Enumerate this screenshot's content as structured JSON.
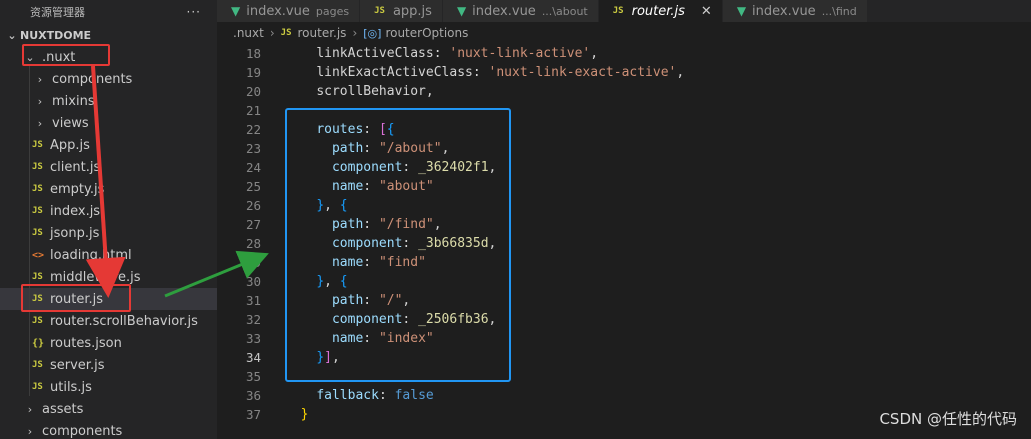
{
  "sidebar": {
    "header_title": "资源管理器",
    "more_label": "···",
    "project": "NUXTDOME",
    "tree": [
      {
        "type": "folder",
        "label": ".nuxt",
        "open": true,
        "depth": 0,
        "icon": "chevron-down"
      },
      {
        "type": "folder",
        "label": "components",
        "open": false,
        "depth": 1,
        "icon": "chevron-right"
      },
      {
        "type": "folder",
        "label": "mixins",
        "open": false,
        "depth": 1,
        "icon": "chevron-right"
      },
      {
        "type": "folder",
        "label": "views",
        "open": false,
        "depth": 1,
        "icon": "chevron-right"
      },
      {
        "type": "js",
        "label": "App.js",
        "depth": 1
      },
      {
        "type": "js",
        "label": "client.js",
        "depth": 1
      },
      {
        "type": "js",
        "label": "empty.js",
        "depth": 1
      },
      {
        "type": "js",
        "label": "index.js",
        "depth": 1
      },
      {
        "type": "js",
        "label": "jsonp.js",
        "depth": 1
      },
      {
        "type": "html",
        "label": "loading.html",
        "depth": 1
      },
      {
        "type": "js",
        "label": "middleware.js",
        "depth": 1
      },
      {
        "type": "js",
        "label": "router.js",
        "depth": 1,
        "selected": true
      },
      {
        "type": "js",
        "label": "router.scrollBehavior.js",
        "depth": 1
      },
      {
        "type": "json",
        "label": "routes.json",
        "depth": 1
      },
      {
        "type": "js",
        "label": "server.js",
        "depth": 1
      },
      {
        "type": "js",
        "label": "utils.js",
        "depth": 1
      },
      {
        "type": "folder",
        "label": "assets",
        "open": false,
        "depth": 0,
        "icon": "chevron-right"
      },
      {
        "type": "folder",
        "label": "components",
        "open": false,
        "depth": 0,
        "icon": "chevron-right"
      }
    ]
  },
  "tabs": [
    {
      "label": "index.vue",
      "hint": "pages",
      "kind": "vue",
      "active": false
    },
    {
      "label": "app.js",
      "hint": "",
      "kind": "js",
      "active": false
    },
    {
      "label": "index.vue",
      "hint": "...\\about",
      "kind": "vue",
      "active": false
    },
    {
      "label": "router.js",
      "hint": "",
      "kind": "js",
      "active": true,
      "close": "✕"
    },
    {
      "label": "index.vue",
      "hint": "...\\find",
      "kind": "vue",
      "active": false
    }
  ],
  "breadcrumb": {
    "folder": ".nuxt",
    "file": "router.js",
    "symbol": "routerOptions"
  },
  "editor": {
    "current_line": 34,
    "lines": [
      {
        "n": 18,
        "tokens": [
          [
            "    ",
            "punc"
          ],
          [
            "linkActiveClass",
            "punc"
          ],
          [
            ": ",
            "punc"
          ],
          [
            "'nuxt-link-active'",
            "str"
          ],
          [
            ",",
            "punc"
          ]
        ]
      },
      {
        "n": 19,
        "tokens": [
          [
            "    ",
            "punc"
          ],
          [
            "linkExactActiveClass",
            "punc"
          ],
          [
            ": ",
            "punc"
          ],
          [
            "'nuxt-link-exact-active'",
            "str"
          ],
          [
            ",",
            "punc"
          ]
        ]
      },
      {
        "n": 20,
        "tokens": [
          [
            "    ",
            "punc"
          ],
          [
            "scrollBehavior",
            "punc"
          ],
          [
            ",",
            "punc"
          ]
        ]
      },
      {
        "n": 21,
        "tokens": []
      },
      {
        "n": 22,
        "tokens": [
          [
            "    ",
            "punc"
          ],
          [
            "routes",
            "prop"
          ],
          [
            ": ",
            "punc"
          ],
          [
            "[",
            "br2"
          ],
          [
            "{",
            "br3"
          ]
        ]
      },
      {
        "n": 23,
        "tokens": [
          [
            "      ",
            "punc"
          ],
          [
            "path",
            "prop"
          ],
          [
            ": ",
            "punc"
          ],
          [
            "\"/about\"",
            "str"
          ],
          [
            ",",
            "punc"
          ]
        ]
      },
      {
        "n": 24,
        "tokens": [
          [
            "      ",
            "punc"
          ],
          [
            "component",
            "prop"
          ],
          [
            ": ",
            "punc"
          ],
          [
            "_362402f1",
            "ident"
          ],
          [
            ",",
            "punc"
          ]
        ]
      },
      {
        "n": 25,
        "tokens": [
          [
            "      ",
            "punc"
          ],
          [
            "name",
            "prop"
          ],
          [
            ": ",
            "punc"
          ],
          [
            "\"about\"",
            "str"
          ]
        ]
      },
      {
        "n": 26,
        "tokens": [
          [
            "    ",
            "punc"
          ],
          [
            "}",
            "br3"
          ],
          [
            ", ",
            "punc"
          ],
          [
            "{",
            "br3"
          ]
        ]
      },
      {
        "n": 27,
        "tokens": [
          [
            "      ",
            "punc"
          ],
          [
            "path",
            "prop"
          ],
          [
            ": ",
            "punc"
          ],
          [
            "\"/find\"",
            "str"
          ],
          [
            ",",
            "punc"
          ]
        ]
      },
      {
        "n": 28,
        "tokens": [
          [
            "      ",
            "punc"
          ],
          [
            "component",
            "prop"
          ],
          [
            ": ",
            "punc"
          ],
          [
            "_3b66835d",
            "ident"
          ],
          [
            ",",
            "punc"
          ]
        ]
      },
      {
        "n": 29,
        "tokens": [
          [
            "      ",
            "punc"
          ],
          [
            "name",
            "prop"
          ],
          [
            ": ",
            "punc"
          ],
          [
            "\"find\"",
            "str"
          ]
        ]
      },
      {
        "n": 30,
        "tokens": [
          [
            "    ",
            "punc"
          ],
          [
            "}",
            "br3"
          ],
          [
            ", ",
            "punc"
          ],
          [
            "{",
            "br3"
          ]
        ]
      },
      {
        "n": 31,
        "tokens": [
          [
            "      ",
            "punc"
          ],
          [
            "path",
            "prop"
          ],
          [
            ": ",
            "punc"
          ],
          [
            "\"/\"",
            "str"
          ],
          [
            ",",
            "punc"
          ]
        ]
      },
      {
        "n": 32,
        "tokens": [
          [
            "      ",
            "punc"
          ],
          [
            "component",
            "prop"
          ],
          [
            ": ",
            "punc"
          ],
          [
            "_2506fb36",
            "ident"
          ],
          [
            ",",
            "punc"
          ]
        ]
      },
      {
        "n": 33,
        "tokens": [
          [
            "      ",
            "punc"
          ],
          [
            "name",
            "prop"
          ],
          [
            ": ",
            "punc"
          ],
          [
            "\"index\"",
            "str"
          ]
        ]
      },
      {
        "n": 34,
        "tokens": [
          [
            "    ",
            "punc"
          ],
          [
            "}",
            "br3"
          ],
          [
            "]",
            "br2"
          ],
          [
            ",",
            "punc"
          ]
        ]
      },
      {
        "n": 35,
        "tokens": []
      },
      {
        "n": 36,
        "tokens": [
          [
            "    ",
            "punc"
          ],
          [
            "fallback",
            "prop"
          ],
          [
            ": ",
            "punc"
          ],
          [
            "false",
            "kw"
          ]
        ]
      },
      {
        "n": 37,
        "tokens": [
          [
            "  ",
            "punc"
          ],
          [
            "}",
            "br1"
          ]
        ]
      }
    ]
  },
  "watermark": "CSDN @任性的代码",
  "colors": {
    "annotation_red": "#e53935",
    "annotation_blue": "#2196f3",
    "annotation_green": "#2e9e3e"
  }
}
